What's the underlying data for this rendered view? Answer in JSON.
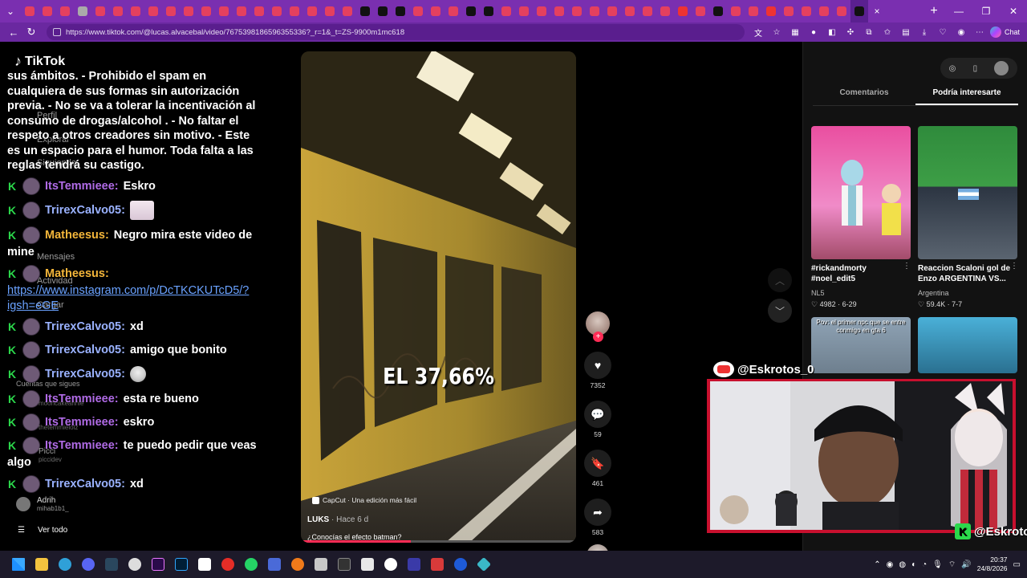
{
  "browser": {
    "url": "https://www.tiktok.com/@lucas.alvacebal/video/7675398186596355336?_r=1&_t=ZS-9900m1mc618",
    "copilot_label": "Chat",
    "new_tab": "+",
    "close_tab": "×",
    "win_min": "—",
    "win_max": "❐",
    "win_close": "✕"
  },
  "tiktok": {
    "logo": "TikTok",
    "sidebar_ghost": [
      "Perfil",
      "Explorar",
      "Siguiendo",
      "Mensajes",
      "Actividad",
      "Cargar",
      "Cuentas que sigues"
    ]
  },
  "chat": {
    "rules_text": "sus ámbitos. - Prohibido el spam en cualquiera de sus formas sin autorización previa. - No se va a tolerar la incentivación al consumo de drogas/alcohol . - No faltar el respeto a otros creadores sin motivo. - Este es un espacio para el humor. Toda falta a las reglas tendrá su castigo.",
    "messages": [
      {
        "user": "ItsTemmieee:",
        "text": "Eskro"
      },
      {
        "user": "TrirexCalvo05:",
        "text": ""
      },
      {
        "user": "Matheesus:",
        "text": "Negro mira este video de"
      },
      {
        "user": "Matheesus:",
        "text": ""
      },
      {
        "user": "TrirexCalvo05:",
        "text": "xd"
      },
      {
        "user": "TrirexCalvo05:",
        "text": "amigo que bonito"
      },
      {
        "user": "TrirexCalvo05:",
        "text": ""
      },
      {
        "user": "ItsTemmieee:",
        "text": "esta re bueno"
      },
      {
        "user": "ItsTemmieee:",
        "text": "eskro"
      },
      {
        "user": "ItsTemmieee:",
        "text": "te puedo pedir que veas"
      },
      {
        "user": "TrirexCalvo05:",
        "text": "xd"
      }
    ],
    "wrap_mine": "mine",
    "wrap_algo": "algo",
    "link": "https://www.instagram.com/p/DcTKCKUTcD5/?igsh=eGE"
  },
  "suggested": [
    {
      "name": "mooncakeannie",
      "sub": ""
    },
    {
      "name": "thetemmielolz",
      "sub": ""
    },
    {
      "name": "Picci",
      "sub": "piccidev"
    },
    {
      "name": "Adrih",
      "sub": "mihab1b1_"
    }
  ],
  "ver_todo": "Ver todo",
  "video": {
    "overlay": "EL 37,66%",
    "capcut": "CapCut · Una edición más fácil",
    "author": "LUKS",
    "time": " · Hace 6 d",
    "desc": "¿Conocías el efecto batman?",
    "progress": 0.4
  },
  "actions": {
    "likes": "7352",
    "comments": "59",
    "saves": "461",
    "shares": "583"
  },
  "panel": {
    "tab_comments": "Comentarios",
    "tab_suggest": "Podría interesarte",
    "videos": [
      {
        "caption": "#rickandmorty #noel_edit5",
        "author": "NL5",
        "stats": "♡ 4982 · 6-29"
      },
      {
        "caption": "Reaccion Scaloni gol de Enzo ARGENTINA VS...",
        "author": "Argentina",
        "stats": "♡ 59.4K · 7-7"
      },
      {
        "caption": "Pov: el primer npc que se entre conmigo en gta 6",
        "author": "",
        "stats": ""
      }
    ]
  },
  "stream": {
    "yt_handle": "@Eskrotos_0",
    "kick_handle": "@Eskrotos"
  },
  "taskbar": {
    "time": "20:37",
    "date": "24/8/2026"
  }
}
